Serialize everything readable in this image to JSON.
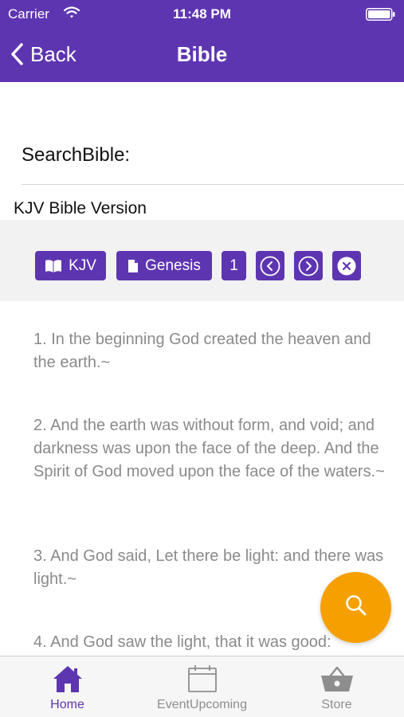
{
  "status_bar": {
    "carrier": "Carrier",
    "time": "11:48 PM"
  },
  "nav": {
    "back_label": "Back",
    "title": "Bible"
  },
  "search": {
    "label": "SearchBible:"
  },
  "version": {
    "label": "KJV Bible Version"
  },
  "toolbar": {
    "version_label": "KJV",
    "book_label": "Genesis",
    "chapter_label": "1"
  },
  "verses": [
    "1. In the beginning God created the heaven and the earth.~",
    "2. And the earth was without form, and void; and darkness was upon the face of the deep. And the Spirit of God moved upon the face of the waters.~",
    "3. And God said, Let there be light: and there was light.~",
    "4. And God saw the light, that it was good:"
  ],
  "tabs": [
    {
      "label": "Home",
      "icon": "home-icon",
      "active": true
    },
    {
      "label": "EventUpcoming",
      "icon": "calendar-icon",
      "active": false
    },
    {
      "label": "Store",
      "icon": "basket-icon",
      "active": false
    }
  ],
  "colors": {
    "primary": "#5e35b1",
    "fab": "#f5a000",
    "verse_text": "#8a8a8a"
  }
}
